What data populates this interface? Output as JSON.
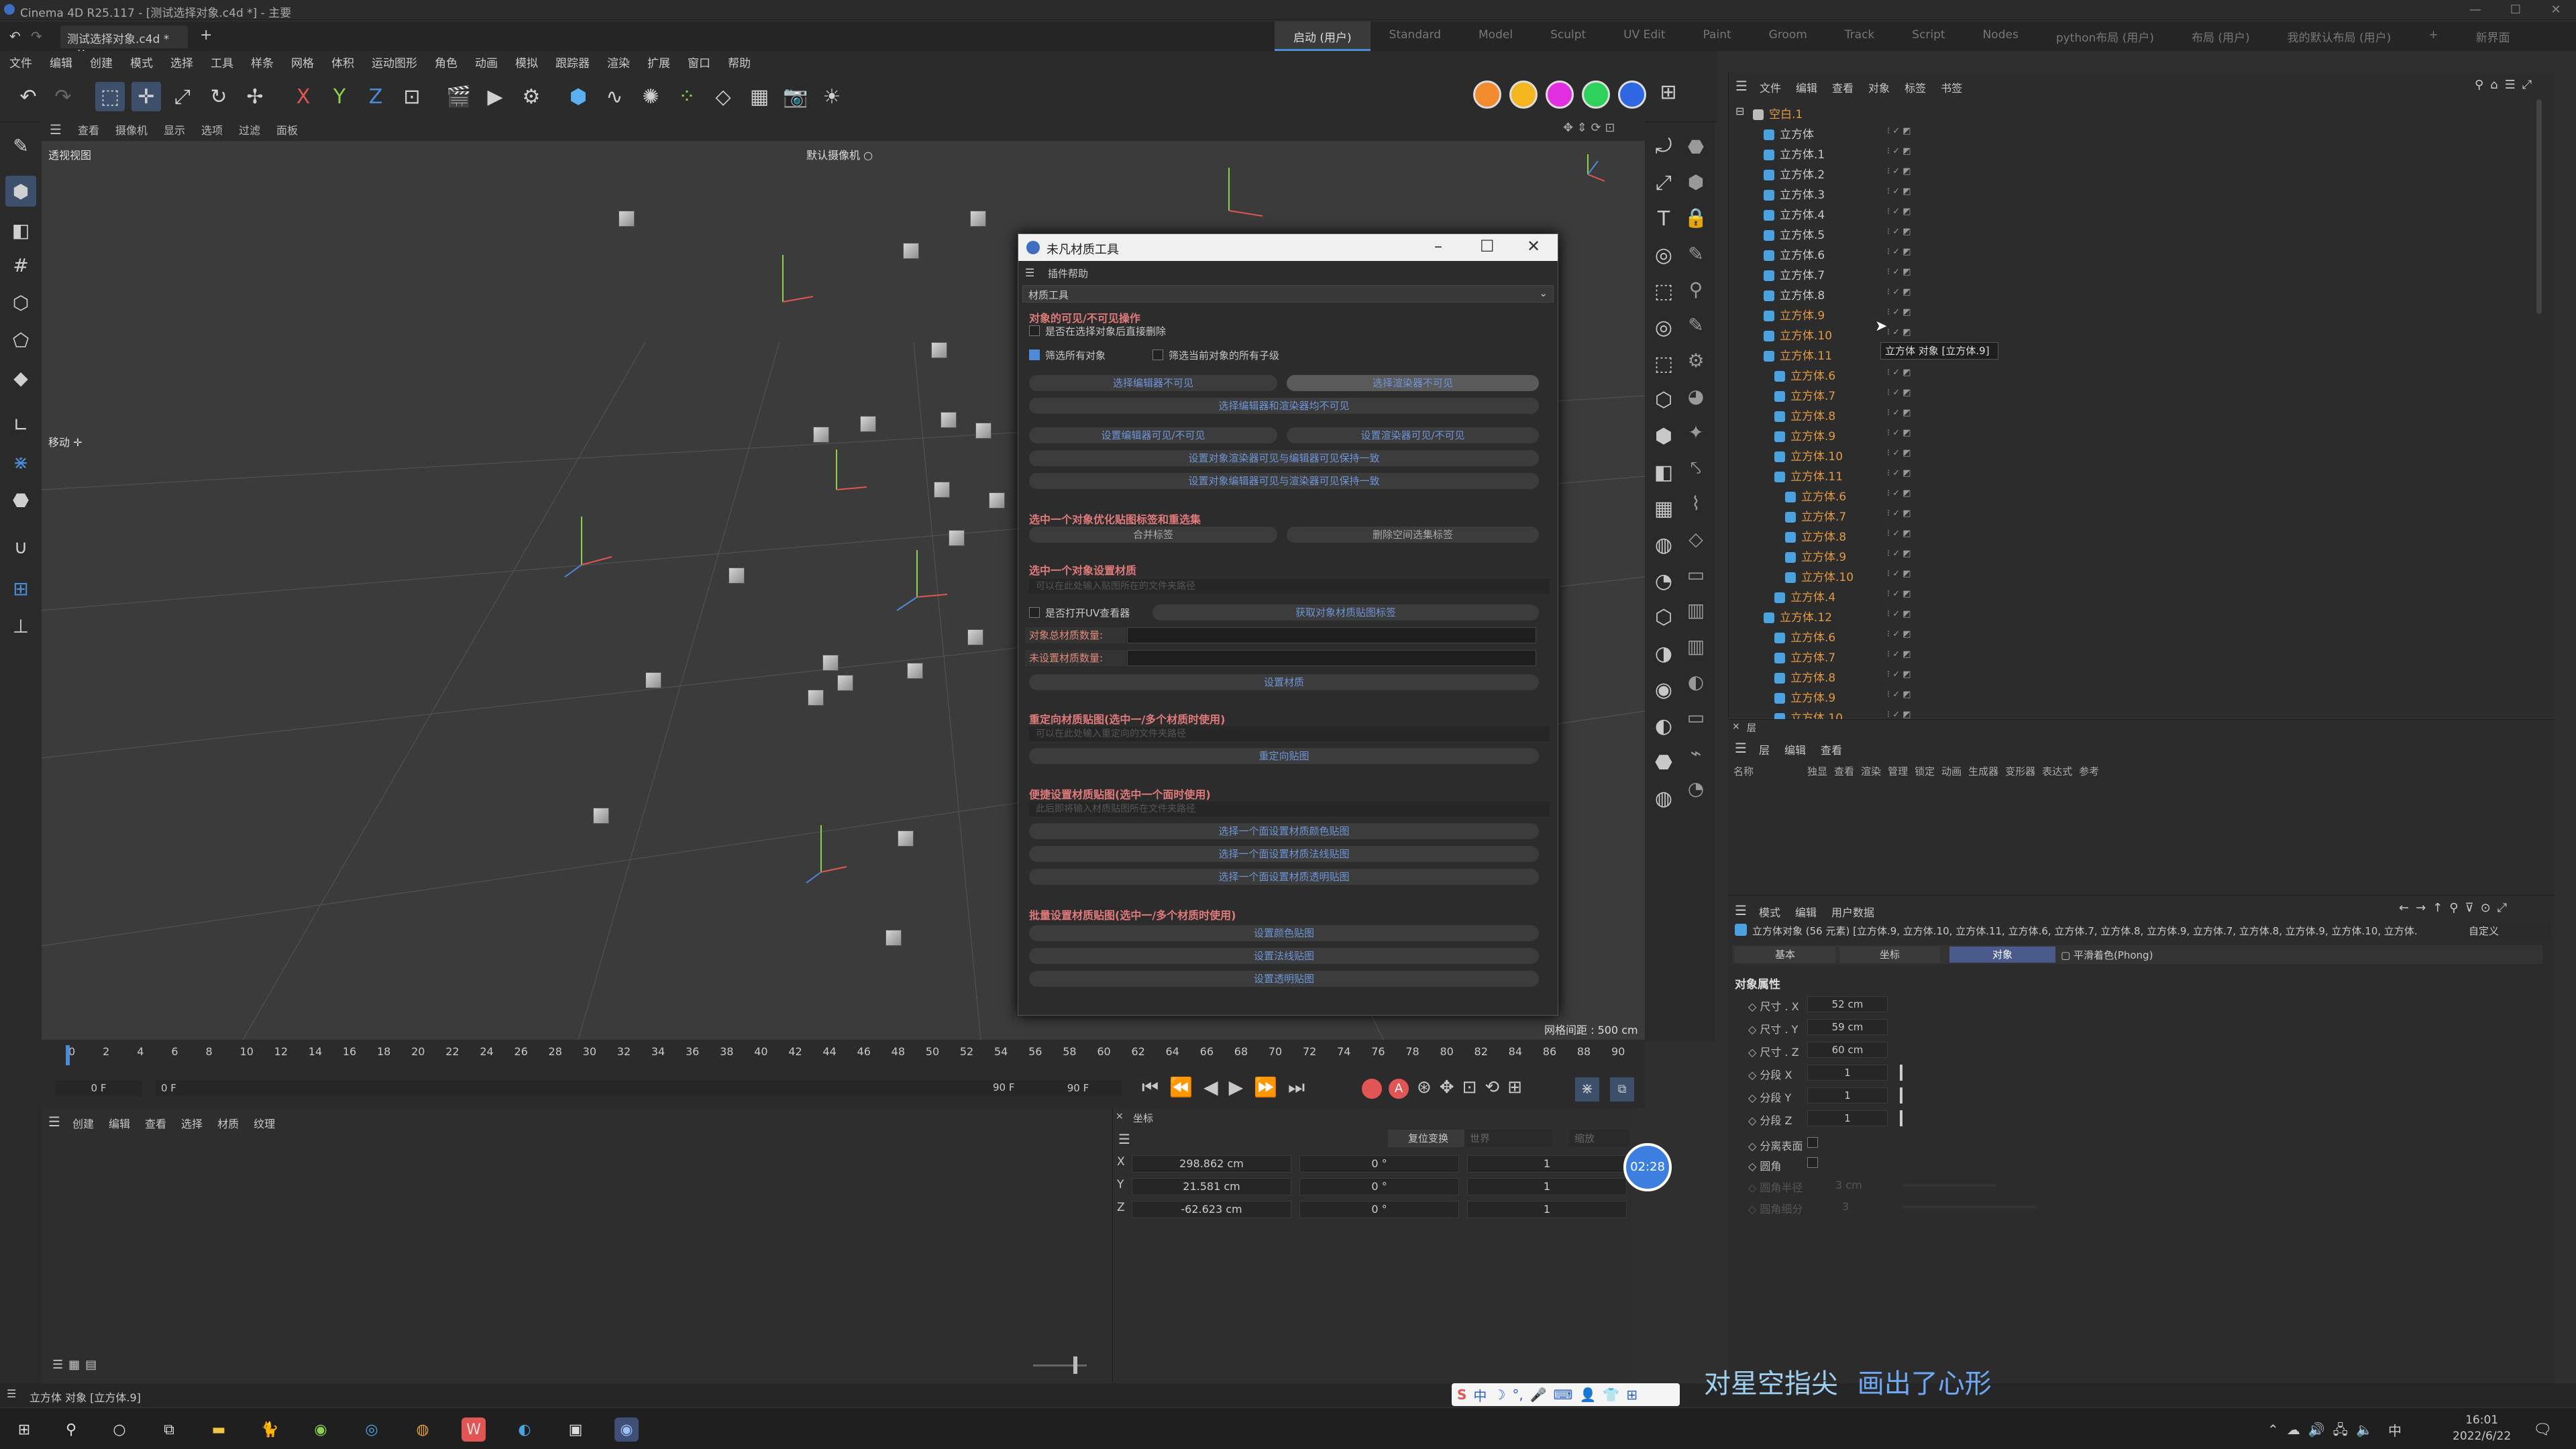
{
  "window": {
    "title": "Cinema 4D R25.117 - [测试选择对象.c4d *] - 主要",
    "controls": [
      "—",
      "☐",
      "✕"
    ]
  },
  "file_tab": {
    "label": "测试选择对象.c4d *",
    "close": "×",
    "add": "+"
  },
  "layouts": [
    "启动 (用户)",
    "Standard",
    "Model",
    "Sculpt",
    "UV Edit",
    "Paint",
    "Groom",
    "Track",
    "Script",
    "Nodes",
    "python布局 (用户)",
    "布局 (用户)",
    "我的默认布局 (用户)",
    "+",
    "新界面"
  ],
  "menu": [
    "文件",
    "编辑",
    "创建",
    "模式",
    "选择",
    "工具",
    "样条",
    "网格",
    "体积",
    "运动图形",
    "角色",
    "动画",
    "模拟",
    "跟踪器",
    "渲染",
    "扩展",
    "窗口",
    "帮助"
  ],
  "viewport": {
    "menu": [
      "查看",
      "摄像机",
      "显示",
      "选项",
      "过滤",
      "面板"
    ],
    "name": "透视视图",
    "camera": "默认摄像机 ○",
    "move_label": "移动 ✛",
    "grid_spacing": "网格间距 : 500 cm"
  },
  "dialog": {
    "title": "未凡材质工具",
    "help_menu": "插件帮助",
    "dropdown": "材质工具",
    "sec1": "对象的可见/不可见操作",
    "opt_delete": "是否在选择对象后直接删除",
    "opt_filter_all": "筛选所有对象",
    "opt_filter_children": "筛选当前对象的所有子级",
    "btn_sel_editor_invisible": "选择编辑器不可见",
    "btn_sel_render_invisible": "选择渲染器不可见",
    "btn_sel_both_invisible": "选择编辑器和渲染器均不可见",
    "btn_set_editor_vis": "设置编辑器可见/不可见",
    "btn_set_render_vis": "设置渲染器可见/不可见",
    "btn_sync_render_to_editor": "设置对象渲染器可见与编辑器可见保持一致",
    "btn_sync_editor_to_render": "设置对象编辑器可见与渲染器可见保持一致",
    "sec2": "选中一个对象优化贴图标签和重选集",
    "btn_merge_tags": "合并标签",
    "btn_delete_empty": "删除空间选集标签",
    "sec3": "选中一个对象设置材质",
    "hint3": "可以在此处输入贴图所在的文件夹路径",
    "opt_uv": "是否打开UV查看器",
    "btn_mat_info": "获取对象材质贴图标签",
    "lbl_total": "对象总材质数量:",
    "lbl_unset": "未设置材质数量:",
    "btn_set_mat": "设置材质",
    "sec4": "重定向材质贴图(选中一/多个材质时使用)",
    "hint4": "可以在此处输入重定向的文件夹路径",
    "btn_redirect": "重定向贴图",
    "sec5": "便捷设置材质贴图(选中一个面时使用)",
    "hint5": "此后即将输入材质贴图所在文件夹路径",
    "btn_color": "选择一个面设置材质颜色贴图",
    "btn_normal": "选择一个面设置材质法线贴图",
    "btn_alpha": "选择一个面设置材质透明贴图",
    "sec6": "批量设置材质贴图(选中一/多个材质时使用)",
    "btn_b_color": "设置颜色贴图",
    "btn_b_normal": "设置法线贴图",
    "btn_b_alpha": "设置透明贴图"
  },
  "timeline": {
    "ticks": [
      "0",
      "2",
      "4",
      "6",
      "8",
      "10",
      "12",
      "14",
      "16",
      "18",
      "20",
      "22",
      "24",
      "26",
      "28",
      "30",
      "32",
      "34",
      "36",
      "38",
      "40",
      "42",
      "44",
      "46",
      "48",
      "50",
      "52",
      "54",
      "56",
      "58",
      "60",
      "62",
      "64",
      "66",
      "68",
      "70",
      "72",
      "74",
      "76",
      "78",
      "80",
      "82",
      "84",
      "86",
      "88",
      "90"
    ],
    "start": "0 F",
    "current": "0 F",
    "end": "90 F",
    "end2": "90 F"
  },
  "material_panel": {
    "menu": [
      "创建",
      "编辑",
      "查看",
      "选择",
      "材质",
      "纹理"
    ]
  },
  "coords": {
    "title": "坐标",
    "reset": "复位变换",
    "world": "世界",
    "scale_mode": "缩放",
    "rows": [
      {
        "axis": "X",
        "pos": "298.862 cm",
        "rot": "0 °",
        "scale": "1"
      },
      {
        "axis": "Y",
        "pos": "21.581 cm",
        "rot": "0 °",
        "scale": "1"
      },
      {
        "axis": "Z",
        "pos": "-62.623 cm",
        "rot": "0 °",
        "scale": "1"
      }
    ],
    "rec": "02:28"
  },
  "object_manager": {
    "menu": [
      "文件",
      "编辑",
      "查看",
      "对象",
      "标签",
      "书签"
    ],
    "root": "空白.1",
    "tooltip": "立方体 对象 [立方体.9]",
    "items": [
      {
        "name": "立方体",
        "indent": 1,
        "orange": false
      },
      {
        "name": "立方体.1",
        "indent": 1,
        "orange": false
      },
      {
        "name": "立方体.2",
        "indent": 1,
        "orange": false
      },
      {
        "name": "立方体.3",
        "indent": 1,
        "orange": false
      },
      {
        "name": "立方体.4",
        "indent": 1,
        "orange": false
      },
      {
        "name": "立方体.5",
        "indent": 1,
        "orange": false
      },
      {
        "name": "立方体.6",
        "indent": 1,
        "orange": false
      },
      {
        "name": "立方体.7",
        "indent": 1,
        "orange": false
      },
      {
        "name": "立方体.8",
        "indent": 1,
        "orange": false
      },
      {
        "name": "立方体.9",
        "indent": 1,
        "orange": true
      },
      {
        "name": "立方体.10",
        "indent": 1,
        "orange": true
      },
      {
        "name": "立方体.11",
        "indent": 1,
        "orange": true
      },
      {
        "name": "立方体.6",
        "indent": 2,
        "orange": true
      },
      {
        "name": "立方体.7",
        "indent": 2,
        "orange": true
      },
      {
        "name": "立方体.8",
        "indent": 2,
        "orange": true
      },
      {
        "name": "立方体.9",
        "indent": 2,
        "orange": true
      },
      {
        "name": "立方体.10",
        "indent": 2,
        "orange": true
      },
      {
        "name": "立方体.11",
        "indent": 2,
        "orange": true
      },
      {
        "name": "立方体.6",
        "indent": 3,
        "orange": true
      },
      {
        "name": "立方体.7",
        "indent": 3,
        "orange": true
      },
      {
        "name": "立方体.8",
        "indent": 3,
        "orange": true
      },
      {
        "name": "立方体.9",
        "indent": 3,
        "orange": true
      },
      {
        "name": "立方体.10",
        "indent": 3,
        "orange": true
      },
      {
        "name": "立方体.4",
        "indent": 2,
        "orange": true
      },
      {
        "name": "立方体.12",
        "indent": 1,
        "orange": true
      },
      {
        "name": "立方体.6",
        "indent": 2,
        "orange": true
      },
      {
        "name": "立方体.7",
        "indent": 2,
        "orange": true
      },
      {
        "name": "立方体.8",
        "indent": 2,
        "orange": true
      },
      {
        "name": "立方体.9",
        "indent": 2,
        "orange": true
      },
      {
        "name": "立方体.10",
        "indent": 2,
        "orange": true
      }
    ]
  },
  "layer_manager": {
    "tab": "层",
    "menu": [
      "层",
      "编辑",
      "查看"
    ],
    "cols": [
      "名称",
      "独显",
      "查看",
      "渲染",
      "管理",
      "锁定",
      "动画",
      "生成器",
      "变形器",
      "表达式",
      "参考"
    ]
  },
  "attr_manager": {
    "menu": [
      "模式",
      "编辑",
      "用户数据"
    ],
    "header": "立方体对象 (56 元素) [立方体.9, 立方体.10, 立方体.11, 立方体.6, 立方体.7, 立方体.8, 立方体.9, 立方体.7, 立方体.8, 立方体.9, 立方体.10, 立方体.",
    "custom": "自定义",
    "tabs": [
      "基本",
      "坐标",
      "对象"
    ],
    "phong": "平滑着色(Phong)",
    "section": "对象属性",
    "rows": [
      {
        "label": "尺寸 . X",
        "value": "52 cm"
      },
      {
        "label": "尺寸 . Y",
        "value": "59 cm"
      },
      {
        "label": "尺寸 . Z",
        "value": "60 cm"
      },
      {
        "label": "分段 X",
        "value": "1"
      },
      {
        "label": "分段 Y",
        "value": "1"
      },
      {
        "label": "分段 Z",
        "value": "1"
      }
    ],
    "sep_faces": "分离表面",
    "fillet": "圆角",
    "fillet_radius": "圆角半径",
    "fillet_radius_val": "3 cm",
    "fillet_sub": "圆角细分",
    "fillet_sub_val": "3"
  },
  "status": {
    "text": "立方体 对象 [立方体.9]"
  },
  "subtitle": {
    "part1": "对星空指尖",
    "part2": "画出了心形"
  },
  "taskbar": {
    "time": "16:01",
    "date": "2022/6/22",
    "ime": "中"
  },
  "colors": {
    "accent": "#4d8bd8",
    "orange": "#e39a45",
    "section_red": "#e07a7a"
  }
}
